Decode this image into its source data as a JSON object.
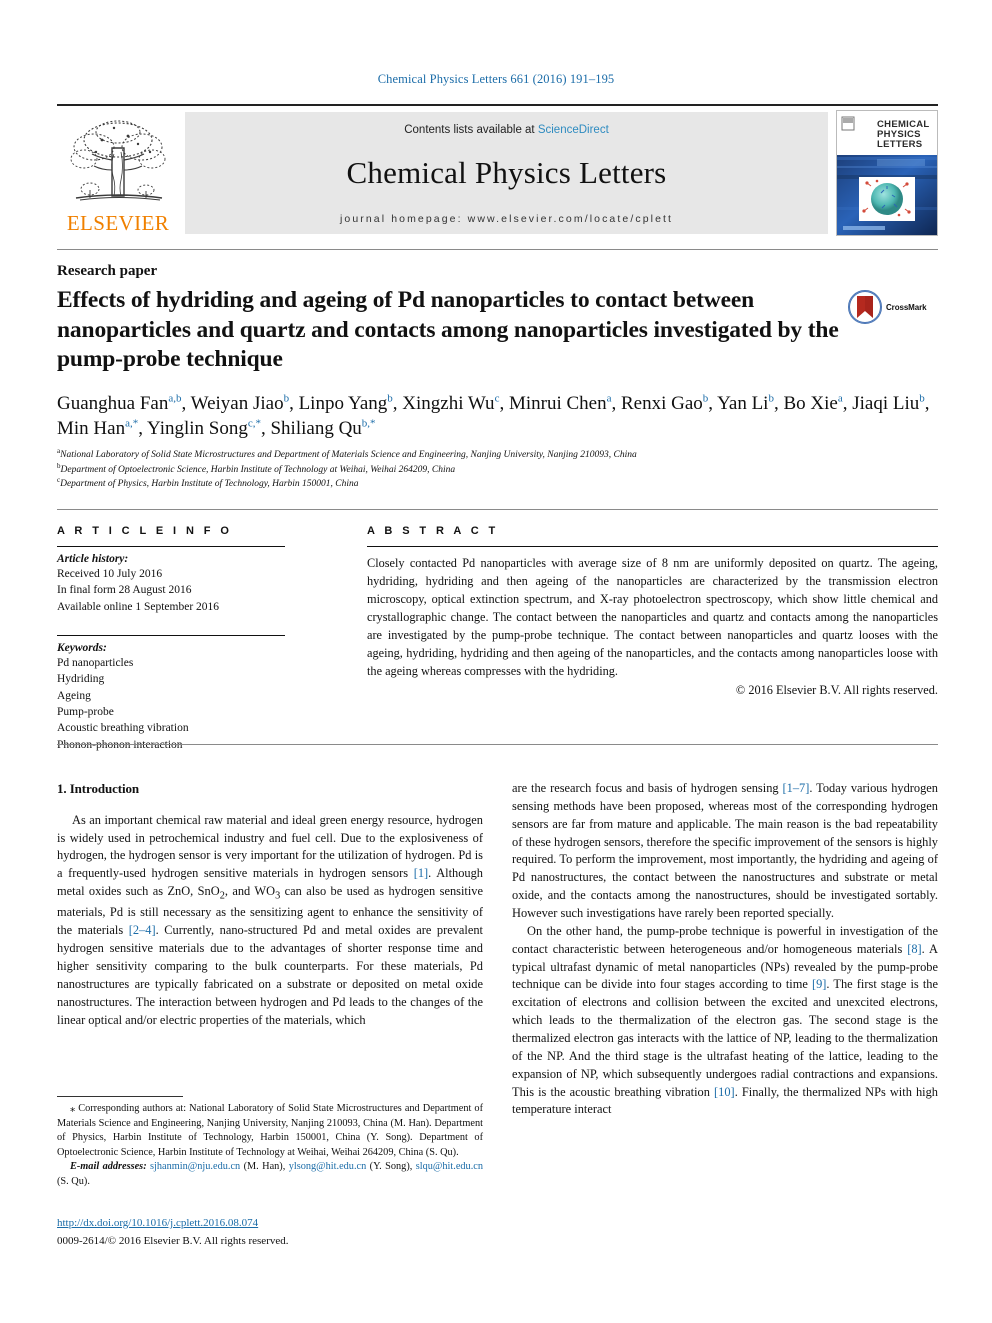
{
  "running_head": "Chemical Physics Letters 661 (2016) 191–195",
  "masthead": {
    "publisher_wordmark": "ELSEVIER",
    "contents_prefix": "Contents lists available at ",
    "contents_link": "ScienceDirect",
    "journal_name": "Chemical Physics Letters",
    "homepage_line": "journal homepage: www.elsevier.com/locate/cplett",
    "cover": {
      "line1": "CHEMICAL",
      "line2": "PHYSICS",
      "line3": "LETTERS"
    }
  },
  "article": {
    "type": "Research paper",
    "title": "Effects of hydriding and ageing of Pd nanoparticles to contact between nanoparticles and quartz and contacts among nanoparticles investigated by the pump-probe technique",
    "crossmark_label": "CrossMark"
  },
  "authors": [
    {
      "name": "Guanghua Fan",
      "marks": "a,b",
      "sep": ", "
    },
    {
      "name": "Weiyan Jiao",
      "marks": "b",
      "sep": ", "
    },
    {
      "name": "Linpo Yang",
      "marks": "b",
      "sep": ", "
    },
    {
      "name": "Xingzhi Wu",
      "marks": "c",
      "sep": ", "
    },
    {
      "name": "Minrui Chen",
      "marks": "a",
      "sep": ", "
    },
    {
      "name": "Renxi Gao",
      "marks": "b",
      "sep": ", "
    },
    {
      "name": "Yan Li",
      "marks": "b",
      "sep": ", "
    },
    {
      "name": "Bo Xie",
      "marks": "a",
      "sep": ", "
    },
    {
      "name": "Jiaqi Liu",
      "marks": "b",
      "sep": ", "
    },
    {
      "name": "Min Han",
      "marks": "a,*",
      "sep": ", "
    },
    {
      "name": "Yinglin Song",
      "marks": "c,*",
      "sep": ", "
    },
    {
      "name": "Shiliang Qu",
      "marks": "b,*",
      "sep": ""
    }
  ],
  "affiliations": [
    {
      "mark": "a",
      "text": "National Laboratory of Solid State Microstructures and Department of Materials Science and Engineering, Nanjing University, Nanjing 210093, China"
    },
    {
      "mark": "b",
      "text": "Department of Optoelectronic Science, Harbin Institute of Technology at Weihai, Weihai 264209, China"
    },
    {
      "mark": "c",
      "text": "Department of Physics, Harbin Institute of Technology, Harbin 150001, China"
    }
  ],
  "article_info": {
    "heading": "A R T I C L E    I N F O",
    "history_label": "Article history:",
    "history": [
      "Received 10 July 2016",
      "In final form 28 August 2016",
      "Available online 1 September 2016"
    ],
    "keywords_label": "Keywords:",
    "keywords": [
      "Pd nanoparticles",
      "Hydriding",
      "Ageing",
      "Pump-probe",
      "Acoustic breathing vibration",
      "Phonon-phonon interaction"
    ]
  },
  "abstract": {
    "heading": "A B S T R A C T",
    "text": "Closely contacted Pd nanoparticles with average size of 8 nm are uniformly deposited on quartz. The ageing, hydriding, hydriding and then ageing of the nanoparticles are characterized by the transmission electron microscopy, optical extinction spectrum, and X-ray photoelectron spectroscopy, which show little chemical and crystallographic change. The contact between the nanoparticles and quartz and contacts among the nanoparticles are investigated by the pump-probe technique. The contact between nanoparticles and quartz looses with the ageing, hydriding, hydriding and then ageing of the nanoparticles, and the contacts among nanoparticles loose with the ageing whereas compresses with the hydriding.",
    "copyright": "© 2016 Elsevier B.V. All rights reserved."
  },
  "body": {
    "section_heading": "1. Introduction",
    "left_paragraph_1_a": "As an important chemical raw material and ideal green energy resource, hydrogen is widely used in petrochemical industry and fuel cell. Due to the explosiveness of hydrogen, the hydrogen sensor is very important for the utilization of hydrogen. Pd is a frequently-used hydrogen sensitive materials in hydrogen sensors ",
    "ref_1": "[1]",
    "left_paragraph_1_b": ". Although metal oxides such as ZnO, SnO",
    "left_paragraph_1_c": ", and WO",
    "left_paragraph_1_d": " can also be used as hydrogen sensitive materials, Pd is still necessary as the sensitizing agent to enhance the sensitivity of the materials ",
    "ref_2_4": "[2–4]",
    "left_paragraph_1_e": ". Currently, nano-structured Pd and metal oxides are prevalent hydrogen sensitive materials due to the advantages of shorter response time and higher sensitivity comparing to the bulk counterparts. For these materials, Pd nanostructures are typically fabricated on a substrate or deposited on metal oxide nanostructures. The interaction between hydrogen and Pd leads to the changes of the linear optical and/or electric properties of the materials, which",
    "right_paragraph_1_a": "are the research focus and basis of hydrogen sensing ",
    "ref_1_7": "[1–7]",
    "right_paragraph_1_b": ". Today various hydrogen sensing methods have been proposed, whereas most of the corresponding hydrogen sensors are far from mature and applicable. The main reason is the bad repeatability of these hydrogen sensors, therefore the specific improvement of the sensors is highly required. To perform the improvement, most importantly, the hydriding and ageing of Pd nanostructures, the contact between the nanostructures and substrate or metal oxide, and the contacts among the nanostructures, should be investigated sortably. However such investigations have rarely been reported specially.",
    "right_paragraph_2_a": "On the other hand, the pump-probe technique is powerful in investigation of the contact characteristic between heterogeneous and/or homogeneous materials ",
    "ref_8": "[8]",
    "right_paragraph_2_b": ". A typical ultrafast dynamic of metal nanoparticles (NPs) revealed by the pump-probe technique can be divide into four stages according to time ",
    "ref_9": "[9]",
    "right_paragraph_2_c": ". The first stage is the excitation of electrons and collision between the excited and unexcited electrons, which leads to the thermalization of the electron gas. The second stage is the thermalized electron gas interacts with the lattice of NP, leading to the thermalization of the NP. And the third stage is the ultrafast heating of the lattice, leading to the expansion of NP, which subsequently undergoes radial contractions and expansions. This is the acoustic breathing vibration ",
    "ref_10": "[10]",
    "right_paragraph_2_d": ". Finally, the thermalized NPs with high temperature interact"
  },
  "footnote": {
    "corresponding": "⁎ Corresponding authors at: National Laboratory of Solid State Microstructures and Department of Materials Science and Engineering, Nanjing University, Nanjing 210093, China (M. Han). Department of Physics, Harbin Institute of Technology, Harbin 150001, China (Y. Song). Department of Optoelectronic Science, Harbin Institute of Technology at Weihai, Weihai 264209, China (S. Qu).",
    "email_label": "E-mail addresses:",
    "emails": [
      {
        "address": "sjhanmin@nju.edu.cn",
        "who": " (M. Han), "
      },
      {
        "address": "ylsong@hit.edu.cn",
        "who": " (Y. Song), "
      },
      {
        "address": "slqu@hit.edu.cn",
        "who": " (S. Qu)."
      }
    ]
  },
  "footer": {
    "doi": "http://dx.doi.org/10.1016/j.cplett.2016.08.074",
    "issn_line": "0009-2614/© 2016 Elsevier B.V. All rights reserved."
  },
  "colors": {
    "link": "#1b6ca8",
    "elsevier_orange": "#F08000",
    "sciencedirect": "#2e8bc0",
    "band_gray": "#e7e7e7"
  }
}
